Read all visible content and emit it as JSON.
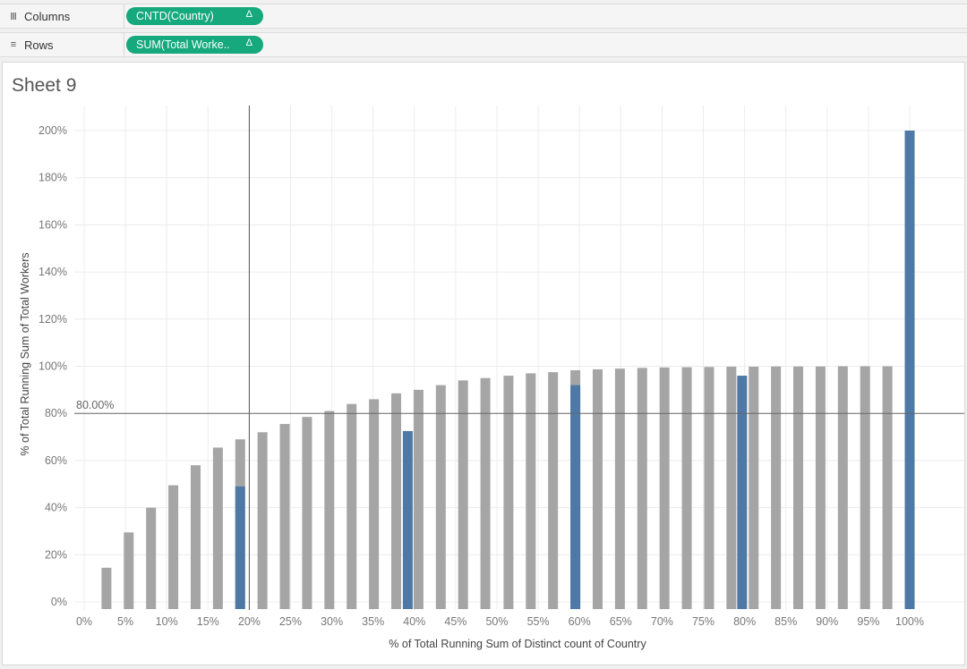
{
  "shelves": {
    "columns": {
      "label": "Columns",
      "icon": "columns-icon",
      "pill": "CNTD(Country)",
      "delta": "Δ"
    },
    "rows": {
      "label": "Rows",
      "icon": "rows-icon",
      "pill": "SUM(Total Worke..",
      "delta": "Δ"
    }
  },
  "sheet": {
    "title": "Sheet 9"
  },
  "colors": {
    "grey_bar": "#a5a5a5",
    "blue_bar": "#4e79a7",
    "pill": "#16a97d"
  },
  "chart_data": {
    "type": "bar",
    "xlabel": "% of Total Running Sum of Distinct count of Country",
    "ylabel": "% of Total Running Sum of Total Workers",
    "xlim": [
      0,
      100
    ],
    "ylim": [
      0,
      200
    ],
    "x_ticks": [
      "0%",
      "5%",
      "10%",
      "15%",
      "20%",
      "25%",
      "30%",
      "35%",
      "40%",
      "45%",
      "50%",
      "55%",
      "60%",
      "65%",
      "70%",
      "75%",
      "80%",
      "85%",
      "90%",
      "95%",
      "100%"
    ],
    "y_ticks": [
      "0%",
      "20%",
      "40%",
      "60%",
      "80%",
      "100%",
      "120%",
      "140%",
      "160%",
      "180%",
      "200%"
    ],
    "reference_line": {
      "value": 80,
      "label": "80.00%"
    },
    "crosshair_x": 20,
    "grey_bars": [
      {
        "x": 2.7,
        "y": 14.5
      },
      {
        "x": 5.4,
        "y": 29.5
      },
      {
        "x": 8.1,
        "y": 40.0
      },
      {
        "x": 10.8,
        "y": 49.5
      },
      {
        "x": 13.5,
        "y": 58.0
      },
      {
        "x": 16.2,
        "y": 65.5
      },
      {
        "x": 18.9,
        "y": 69.0
      },
      {
        "x": 21.6,
        "y": 72.0
      },
      {
        "x": 24.3,
        "y": 75.5
      },
      {
        "x": 27.0,
        "y": 78.5
      },
      {
        "x": 29.7,
        "y": 81.0
      },
      {
        "x": 32.4,
        "y": 84.0
      },
      {
        "x": 35.1,
        "y": 86.0
      },
      {
        "x": 37.8,
        "y": 88.5
      },
      {
        "x": 40.5,
        "y": 90.0
      },
      {
        "x": 43.2,
        "y": 92.0
      },
      {
        "x": 45.9,
        "y": 94.0
      },
      {
        "x": 48.6,
        "y": 95.0
      },
      {
        "x": 51.4,
        "y": 96.0
      },
      {
        "x": 54.1,
        "y": 97.0
      },
      {
        "x": 56.8,
        "y": 97.5
      },
      {
        "x": 59.5,
        "y": 98.3
      },
      {
        "x": 62.2,
        "y": 98.7
      },
      {
        "x": 64.9,
        "y": 99.0
      },
      {
        "x": 67.6,
        "y": 99.3
      },
      {
        "x": 70.3,
        "y": 99.5
      },
      {
        "x": 73.0,
        "y": 99.6
      },
      {
        "x": 75.7,
        "y": 99.7
      },
      {
        "x": 78.4,
        "y": 99.8
      },
      {
        "x": 81.1,
        "y": 99.8
      },
      {
        "x": 83.8,
        "y": 99.9
      },
      {
        "x": 86.5,
        "y": 99.9
      },
      {
        "x": 89.2,
        "y": 99.9
      },
      {
        "x": 91.9,
        "y": 100.0
      },
      {
        "x": 94.6,
        "y": 100.0
      },
      {
        "x": 97.3,
        "y": 100.0
      },
      {
        "x": 100.0,
        "y": 100.0
      }
    ],
    "blue_bars": [
      {
        "x": 18.9,
        "y": 49.0
      },
      {
        "x": 39.2,
        "y": 72.5
      },
      {
        "x": 59.5,
        "y": 92.0
      },
      {
        "x": 79.7,
        "y": 96.0
      },
      {
        "x": 100.0,
        "y": 200.0
      }
    ]
  }
}
